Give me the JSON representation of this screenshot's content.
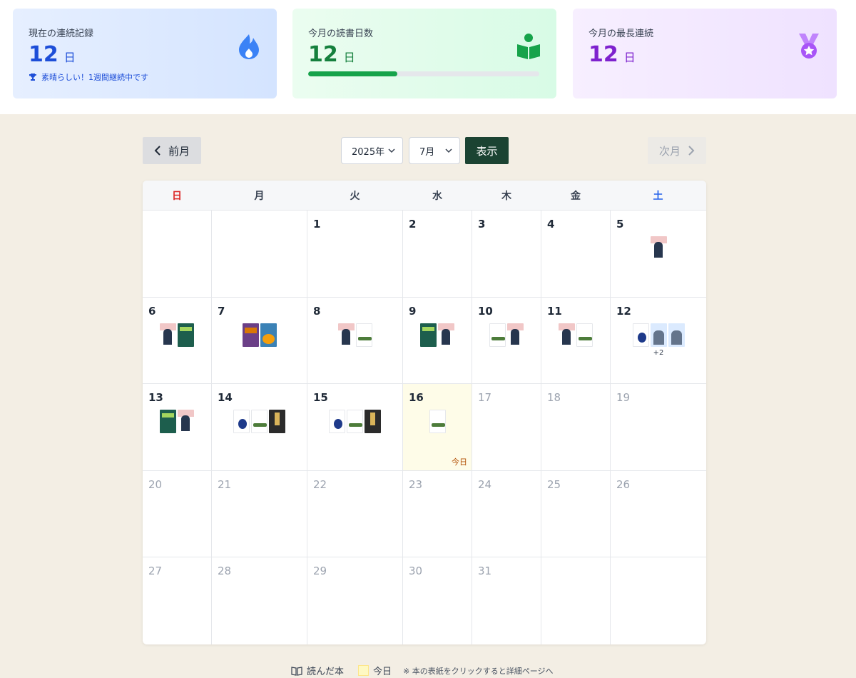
{
  "stats": [
    {
      "label": "現在の連続記録",
      "value": "12",
      "unit": "日",
      "note": "素晴らしい！1週間継続中です",
      "icon": "flame-icon"
    },
    {
      "label": "今月の読書日数",
      "value": "12",
      "unit": "日",
      "progress": 0.387,
      "icon": "reader-book-icon"
    },
    {
      "label": "今月の最長連続",
      "value": "12",
      "unit": "日",
      "icon": "medal-icon"
    }
  ],
  "nav": {
    "prev_label": "前月",
    "next_label": "次月",
    "year_selected": "2025年",
    "month_selected": "7月",
    "show_label": "表示"
  },
  "calendar": {
    "weekdays": [
      "日",
      "月",
      "火",
      "水",
      "木",
      "金",
      "土"
    ],
    "today_label": "今日",
    "weeks": [
      [
        {
          "d": ""
        },
        {
          "d": ""
        },
        {
          "d": "1"
        },
        {
          "d": "2"
        },
        {
          "d": "3"
        },
        {
          "d": "4"
        },
        {
          "d": "5",
          "books": [
            "person"
          ]
        }
      ],
      [
        {
          "d": "6",
          "books": [
            "person",
            "green"
          ]
        },
        {
          "d": "7",
          "books": [
            "purple",
            "orange"
          ]
        },
        {
          "d": "8",
          "books": [
            "person",
            "plane"
          ]
        },
        {
          "d": "9",
          "books": [
            "green",
            "person"
          ]
        },
        {
          "d": "10",
          "books": [
            "plane",
            "person"
          ]
        },
        {
          "d": "11",
          "books": [
            "person",
            "plane"
          ]
        },
        {
          "d": "12",
          "books": [
            "paper",
            "manga",
            "manga"
          ],
          "more": "+2"
        }
      ],
      [
        {
          "d": "13",
          "books": [
            "green",
            "person"
          ]
        },
        {
          "d": "14",
          "books": [
            "paper",
            "plane",
            "dark"
          ]
        },
        {
          "d": "15",
          "books": [
            "paper",
            "plane",
            "dark"
          ]
        },
        {
          "d": "16",
          "books": [
            "plane"
          ],
          "today": true
        },
        {
          "d": "17",
          "future": true
        },
        {
          "d": "18",
          "future": true
        },
        {
          "d": "19",
          "future": true
        }
      ],
      [
        {
          "d": "20",
          "future": true
        },
        {
          "d": "21",
          "future": true
        },
        {
          "d": "22",
          "future": true
        },
        {
          "d": "23",
          "future": true
        },
        {
          "d": "24",
          "future": true
        },
        {
          "d": "25",
          "future": true
        },
        {
          "d": "26",
          "future": true
        }
      ],
      [
        {
          "d": "27",
          "future": true
        },
        {
          "d": "28",
          "future": true
        },
        {
          "d": "29",
          "future": true
        },
        {
          "d": "30",
          "future": true
        },
        {
          "d": "31",
          "future": true
        },
        {
          "d": ""
        },
        {
          "d": ""
        }
      ]
    ]
  },
  "legend": {
    "read_label": "読んだ本",
    "today_label": "今日",
    "note": "※ 本の表紙をクリックすると詳細ページへ"
  }
}
